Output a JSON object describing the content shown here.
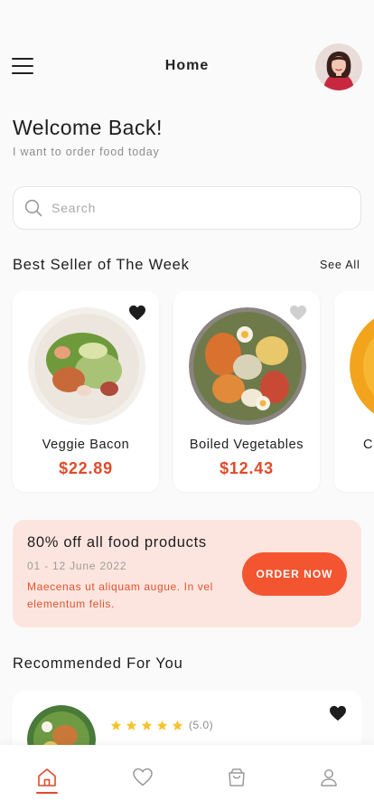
{
  "header": {
    "title": "Home",
    "menu_icon": "hamburger-icon",
    "avatar": "user-avatar"
  },
  "welcome": {
    "title": "Welcome Back!",
    "subtitle": "I want to order food today"
  },
  "search": {
    "placeholder": "Search",
    "value": "",
    "icon": "search-icon"
  },
  "best_seller": {
    "title": "Best Seller of The Week",
    "see_all": "See All",
    "items": [
      {
        "name": "Veggie Bacon",
        "price": "$22.89",
        "favorite": true
      },
      {
        "name": "Boiled Vegetables",
        "price": "$12.43",
        "favorite": false
      },
      {
        "name": "C",
        "price": "",
        "favorite": false
      }
    ]
  },
  "promo": {
    "title": "80% off all food products",
    "date": "01 - 12 June 2022",
    "description": "Maecenas ut aliquam augue. In vel elementum felis.",
    "button": "ORDER NOW"
  },
  "recommended": {
    "title": "Recommended For You",
    "items": [
      {
        "name": "",
        "price": "",
        "rating": "(5.0)",
        "stars": 5,
        "favorite": true
      }
    ]
  },
  "tabbar": {
    "tabs": [
      {
        "name": "home-icon",
        "active": true
      },
      {
        "name": "heart-icon",
        "active": false
      },
      {
        "name": "bag-icon",
        "active": false
      },
      {
        "name": "profile-icon",
        "active": false
      }
    ]
  },
  "colors": {
    "accent": "#e04a2a",
    "button": "#f35530",
    "promo_bg": "#fde5df",
    "heart_active": "#1d1d1d",
    "heart_inactive": "#cfcfcf",
    "star": "#f7c32e"
  }
}
